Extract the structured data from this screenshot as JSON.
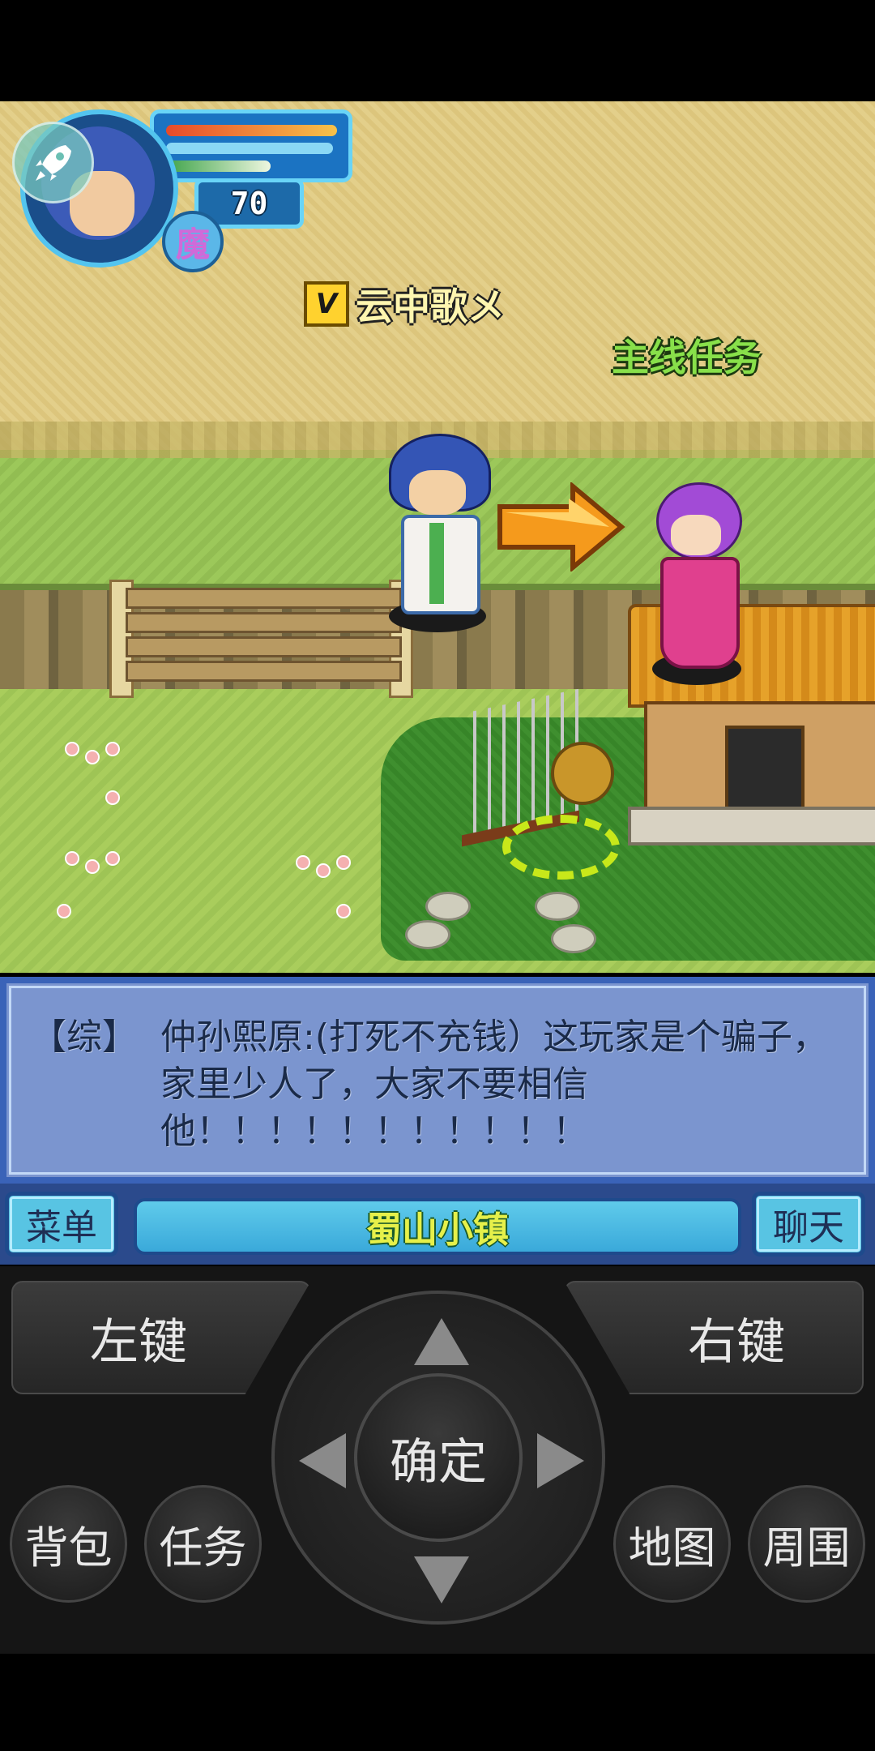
{
  "player": {
    "vip_badge": "V",
    "name": "云中歌メ",
    "level": "70",
    "faction": "魔",
    "hp_fraction": 0.98,
    "mp_fraction": 0.96,
    "exp_fraction": 0.6
  },
  "npc": {
    "label": "主线任务"
  },
  "chat": {
    "channel": "【综】",
    "message": "仲孙熙原:(打死不充钱）这玩家是个骗子，家里少人了，大家不要相信他！！！！！！！！！！！"
  },
  "bottom_bar": {
    "menu_label": "菜单",
    "location": "蜀山小镇",
    "chat_label": "聊天"
  },
  "keypad": {
    "left_soft": "左键",
    "right_soft": "右键",
    "ok": "确定",
    "bag": "背包",
    "quest": "任务",
    "map": "地图",
    "nearby": "周围"
  },
  "colors": {
    "hp": "#e84a2a",
    "mp": "#8ad8f5",
    "exp": "#66c04a",
    "chat_bg": "#7b95cf",
    "location_text": "#e6f04a",
    "quest_label": "#88e04a"
  },
  "icons": [
    "rocket-icon",
    "arrow-right-icon",
    "dpad-up-icon",
    "dpad-down-icon",
    "dpad-left-icon",
    "dpad-right-icon"
  ]
}
